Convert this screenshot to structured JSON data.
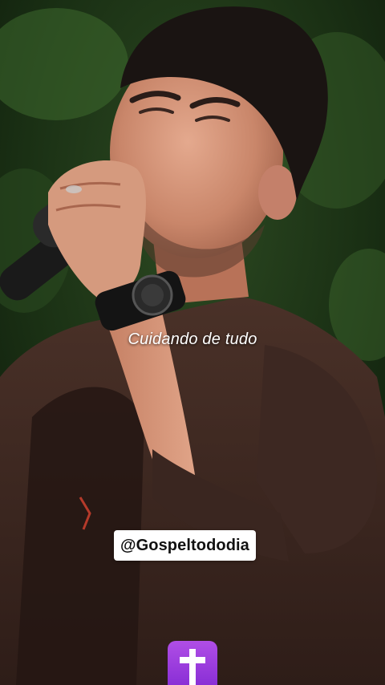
{
  "video": {
    "subject": "man-singing-into-microphone"
  },
  "caption": {
    "text": "Cuidando de tudo"
  },
  "watermark": {
    "handle": "@Gospeltododia"
  },
  "emoji": {
    "icon": "latin-cross-icon",
    "color": "#9b3fe0"
  }
}
